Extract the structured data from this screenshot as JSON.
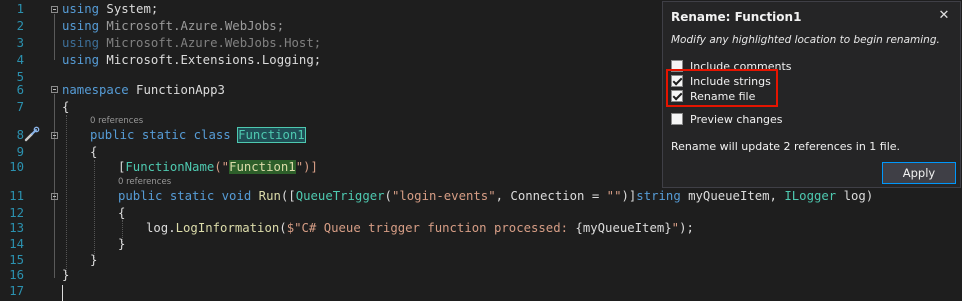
{
  "editor": {
    "line_numbers": [
      "1",
      "2",
      "3",
      "4",
      "5",
      "6",
      "7",
      "8",
      "9",
      "10",
      "11",
      "12",
      "13",
      "14",
      "15",
      "16",
      "17"
    ],
    "codelens": [
      "0 references",
      "0 references"
    ],
    "lines": {
      "l1": {
        "kw": "using",
        "rest": " System;"
      },
      "l2": {
        "kw": "using",
        "rest": " Microsoft.Azure.WebJobs;"
      },
      "l3": {
        "kw": "using",
        "rest": " Microsoft.Azure.WebJobs.Host;"
      },
      "l4": {
        "kw": "using",
        "rest": " Microsoft.Extensions.Logging;"
      },
      "l6": {
        "kw": "namespace",
        "rest": " FunctionApp3"
      },
      "l7": {
        "text": "{"
      },
      "l8": {
        "kw": "public static class",
        "name": "Function1"
      },
      "l9": {
        "text": "{"
      },
      "l10": {
        "open": "[",
        "attr": "FunctionName",
        "paren": "(\"",
        "str": "Function1",
        "close": "\")]"
      },
      "l11": {
        "kw": "public static void",
        "method": " Run",
        "p1": "([",
        "attr": "QueueTrigger",
        "p2": "(",
        "str1": "\"login-events\"",
        "p3": ", Connection = ",
        "str2": "\"\"",
        "p4": ")]",
        "kw2": "string",
        "p5": " myQueueItem, ",
        "ty": "ILogger",
        "p6": " log)"
      },
      "l12": {
        "text": "{"
      },
      "l13": {
        "obj": "log.",
        "method": "LogInformation",
        "p1": "(",
        "str": "$\"C# Queue trigger function processed: ",
        "interp": "{myQueueItem}",
        "str_end": "\"",
        "p2": ");"
      },
      "l14": {
        "text": "}"
      },
      "l15": {
        "text": "}"
      },
      "l16": {
        "text": "}"
      }
    }
  },
  "rename_panel": {
    "title": "Rename: Function1",
    "subtitle": "Modify any highlighted location to begin renaming.",
    "options": [
      {
        "label": "Include comments",
        "checked": false
      },
      {
        "label": "Include strings",
        "checked": true
      },
      {
        "label": "Rename file",
        "checked": true
      },
      {
        "label": "Preview changes",
        "checked": false
      }
    ],
    "summary": "Rename will update 2 references in 1 file.",
    "apply_label": "Apply",
    "close_glyph": "✕"
  },
  "colors": {
    "keyword": "#569cd6",
    "type": "#4ec9b0",
    "string": "#d69d85",
    "highlight_box": "#e51400",
    "apply_border": "#0097fb"
  }
}
